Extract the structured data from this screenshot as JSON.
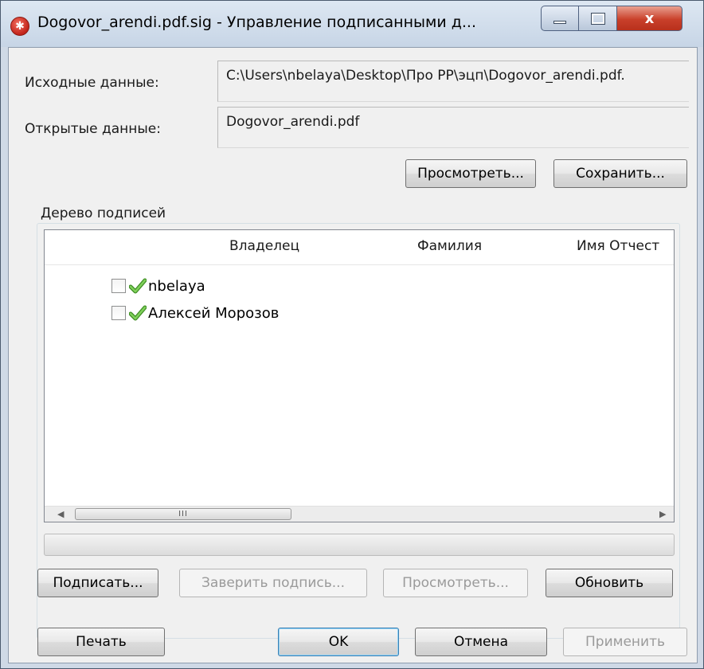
{
  "window": {
    "title": "Dogovor_arendi.pdf.sig - Управление подписанными д...",
    "close_glyph": "x",
    "app_icon": "signature-app-icon"
  },
  "fields": {
    "source_label": "Исходные данные:",
    "source_value": "C:\\Users\\nbelaya\\Desktop\\Про РР\\эцп\\Dogovor_arendi.pdf.",
    "open_label": "Открытые данные:",
    "open_value": "Dogovor_arendi.pdf"
  },
  "data_buttons": {
    "view": "Просмотреть...",
    "save": "Сохранить..."
  },
  "tree": {
    "group_label": "Дерево подписей",
    "columns": [
      "Владелец",
      "Фамилия",
      "Имя Отчест"
    ],
    "rows": [
      {
        "name": "nbelaya",
        "checked": false,
        "status_icon": "valid-check-icon"
      },
      {
        "name": "Алексей Морозов",
        "checked": false,
        "status_icon": "valid-check-icon"
      }
    ],
    "scroll_thumb_grip": "III"
  },
  "sign_buttons": {
    "sign": "Подписать...",
    "certify": "Заверить подпись...",
    "view": "Просмотреть...",
    "refresh": "Обновить"
  },
  "footer_buttons": {
    "print": "Печать",
    "ok": "OK",
    "cancel": "Отмена",
    "apply": "Применить"
  },
  "colors": {
    "check_green": "#5ab33a",
    "close_red": "#c9402a"
  }
}
